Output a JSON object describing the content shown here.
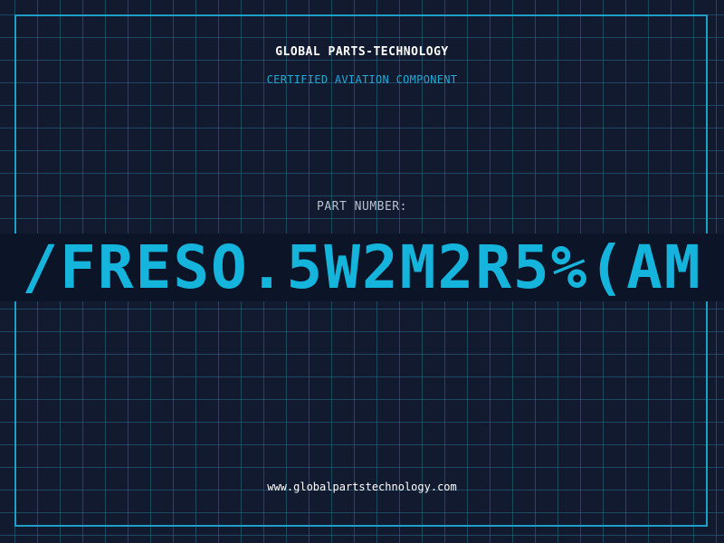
{
  "header": {
    "company": "GLOBAL PARTS-TECHNOLOGY",
    "subtitle": "CERTIFIED AVIATION COMPONENT"
  },
  "part": {
    "label": "PART NUMBER:",
    "number": "/FRESO.5W2M2R5%(AM"
  },
  "footer": {
    "url": "www.globalpartstechnology.com"
  },
  "colors": {
    "background": "#111a2e",
    "grid": "#1f5f7a",
    "accent": "#14b4dc"
  }
}
